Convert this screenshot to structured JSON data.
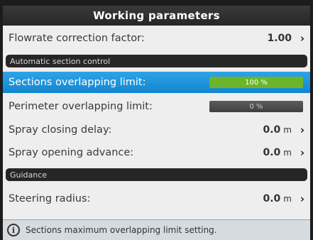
{
  "header": {
    "title": "Working parameters"
  },
  "rows": {
    "flowrate": {
      "label": "Flowrate correction factor:",
      "value": "1.00",
      "chevron": "›"
    },
    "sections_overlap": {
      "label": "Sections overlapping limit:",
      "value": "100 %",
      "fill_percent": 100
    },
    "perimeter_overlap": {
      "label": "Perimeter overlapping limit:",
      "value": "0 %",
      "fill_percent": 0
    },
    "spray_closing": {
      "label": "Spray closing delay:",
      "value": "0.0",
      "unit": "m",
      "chevron": "›"
    },
    "spray_opening": {
      "label": "Spray opening advance:",
      "value": "0.0",
      "unit": "m",
      "chevron": "›"
    },
    "steering_radius": {
      "label": "Steering radius:",
      "value": "0.0",
      "unit": "m",
      "chevron": "›"
    }
  },
  "sections": {
    "automatic": "Automatic section control",
    "guidance": "Guidance"
  },
  "info": {
    "icon": "info-icon",
    "text": "Sections maximum overlapping limit setting."
  },
  "colors": {
    "selected_row": "#1b8fd8",
    "bar_fill": "#6cb52a",
    "bar_empty": "#4a4a4a"
  }
}
